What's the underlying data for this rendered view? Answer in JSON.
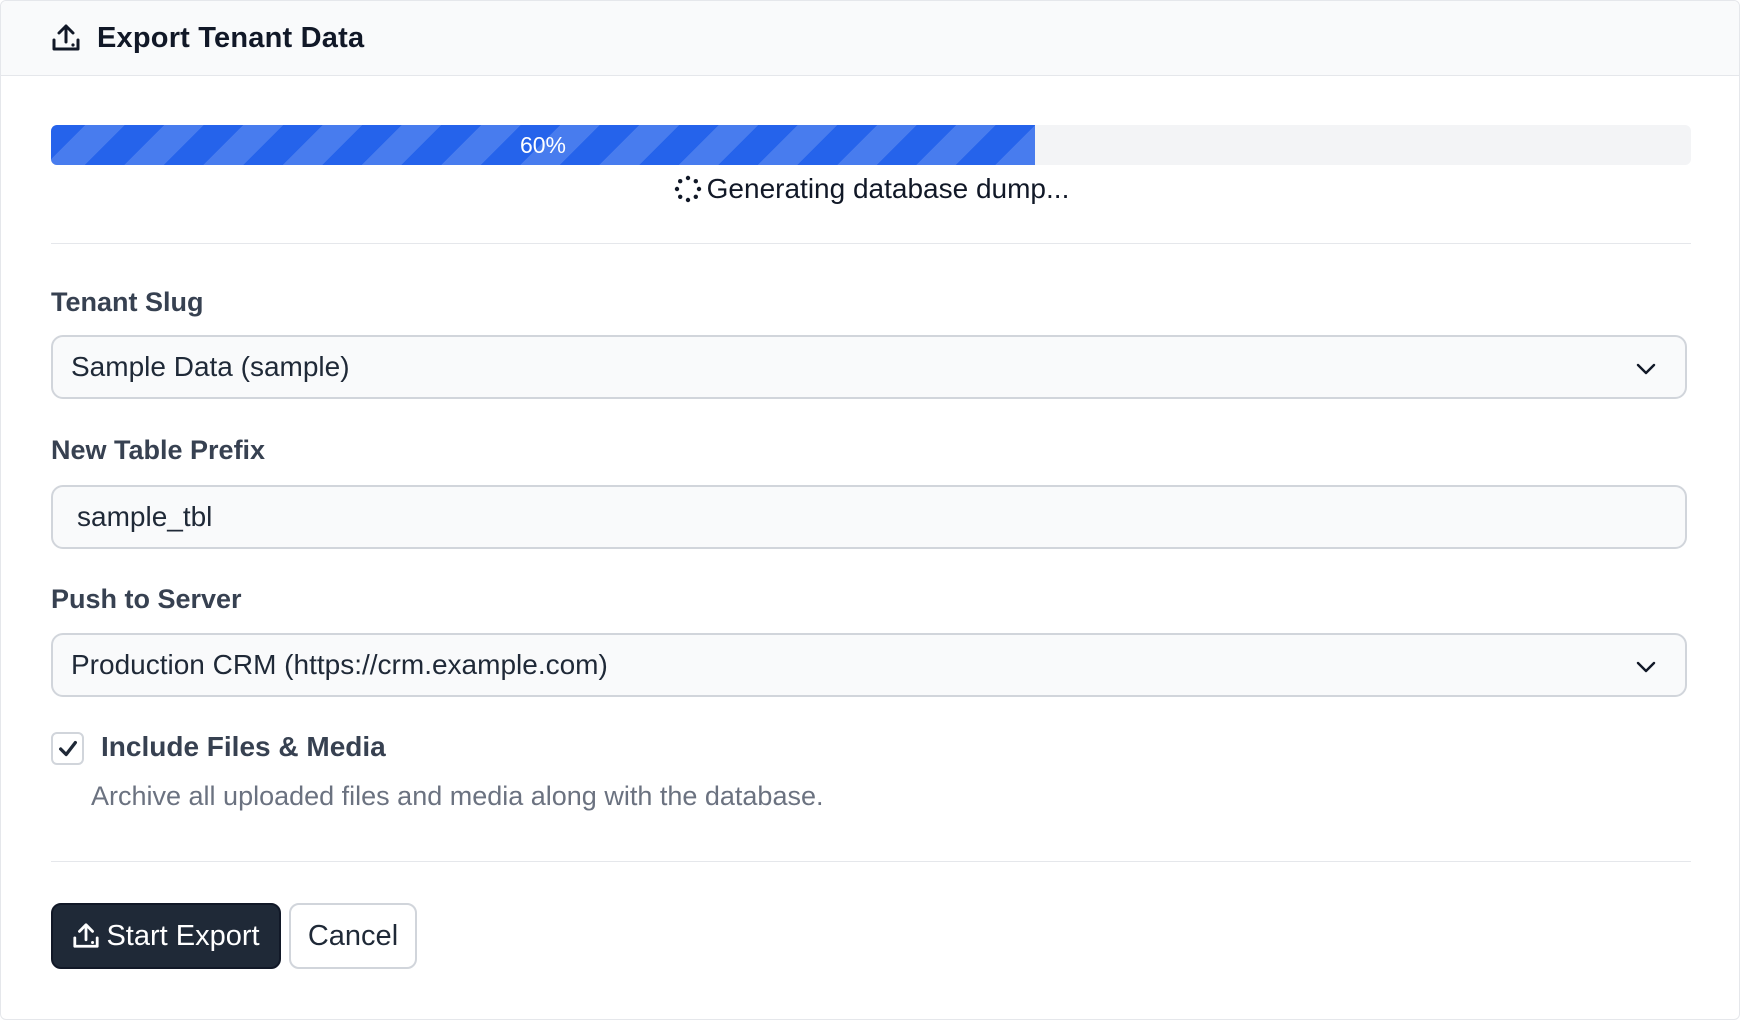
{
  "header": {
    "title": "Export Tenant Data",
    "icon": "upload-icon"
  },
  "progress": {
    "percent": 60,
    "label": "60%",
    "status": "Generating database dump..."
  },
  "form": {
    "tenant_slug": {
      "label": "Tenant Slug",
      "selected": "Sample Data (sample)"
    },
    "table_prefix": {
      "label": "New Table Prefix",
      "value": "sample_tbl"
    },
    "push_server": {
      "label": "Push to Server",
      "selected": "Production CRM (https://crm.example.com)"
    },
    "include_files": {
      "label": "Include Files & Media",
      "checked": true,
      "help": "Archive all uploaded files and media along with the database."
    }
  },
  "actions": {
    "start_label": "Start Export",
    "cancel_label": "Cancel"
  },
  "colors": {
    "accent": "#2563eb",
    "primary_button": "#1f2937",
    "track": "#f3f4f6"
  }
}
